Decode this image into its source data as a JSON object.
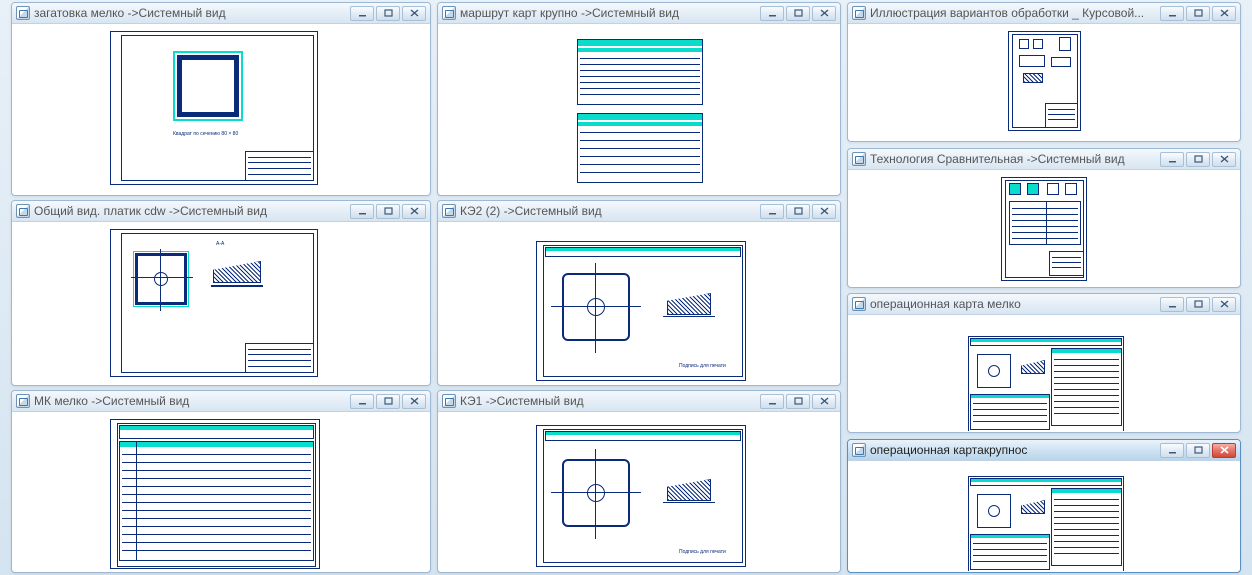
{
  "windows": {
    "w1": {
      "title": "загатовка мелко  ->Системный вид"
    },
    "w2": {
      "title": "маршрут карт крупно ->Системный вид"
    },
    "w3": {
      "title": "Иллюстрация вариантов обработки _ Курсовой..."
    },
    "w4": {
      "title": "Общий вид.  платик cdw ->Системный вид"
    },
    "w5": {
      "title": "КЭ2 (2) ->Системный вид"
    },
    "w6": {
      "title": "Технология Сравнительная ->Системный вид"
    },
    "w7": {
      "title": "МК мелко ->Системный вид"
    },
    "w8": {
      "title": "КЭ1 ->Системный вид"
    },
    "w9": {
      "title": "операционная карта мелко"
    },
    "w10": {
      "title": "операционная картакрупнос"
    }
  },
  "controls": {
    "minimize": "minimize",
    "maximize": "maximize",
    "close": "close"
  },
  "colors": {
    "frame": "#0a2a7a",
    "accent": "#0adccc"
  }
}
